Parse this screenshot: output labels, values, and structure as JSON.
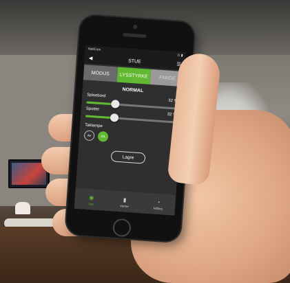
{
  "status": {
    "carrier": "NetCom",
    "signal": "wifi",
    "right": "⊙ ▮"
  },
  "nav": {
    "back_icon": "arrow-left-icon",
    "title": "STUE",
    "menu_icon": "hamburger-menu-icon"
  },
  "tabs": [
    {
      "label": "MODUS",
      "state": "normal"
    },
    {
      "label": "LYSSTYRKE",
      "state": "active"
    },
    {
      "label": "FARGE",
      "state": "dim"
    }
  ],
  "mode": "NORMAL",
  "sliders": [
    {
      "label": "Spisebord",
      "value_text": "32 %",
      "value": 32
    },
    {
      "label": "Spotter",
      "value_text": "32 %",
      "value": 32
    }
  ],
  "toggle_group": {
    "label": "Taklampe",
    "options": [
      {
        "label": "AV",
        "on": false
      },
      {
        "label": "PÅ",
        "on": true
      }
    ]
  },
  "save_label": "Lagre",
  "bottom_nav": [
    {
      "icon": "lightbulb-icon",
      "label": "Lys",
      "active": true
    },
    {
      "icon": "thermometer-icon",
      "label": "Varme",
      "active": false
    },
    {
      "icon": "gauge-icon",
      "label": "Måling",
      "active": false
    }
  ],
  "colors": {
    "accent": "#61b931",
    "screen_bg": "#2f2f2f"
  }
}
